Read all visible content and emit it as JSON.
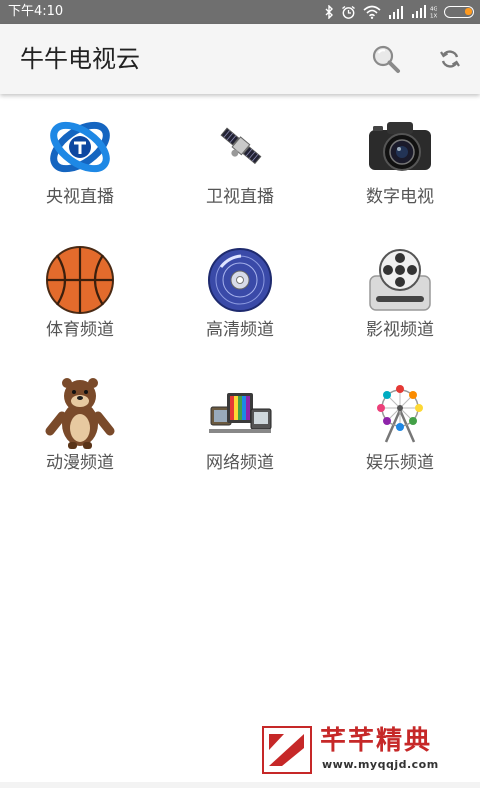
{
  "status_bar": {
    "time": "下午4:10",
    "icons": [
      "bluetooth-icon",
      "alarm-icon",
      "wifi-icon",
      "signal-icon",
      "signal-icon",
      "battery-icon"
    ],
    "battery_level": 0.25,
    "network_labels": [
      "4G",
      "1X"
    ]
  },
  "app_bar": {
    "title": "牛牛电视云",
    "actions": [
      "search-icon",
      "refresh-icon"
    ]
  },
  "grid": {
    "items": [
      {
        "label": "央视直播",
        "icon": "cctv-logo-icon"
      },
      {
        "label": "卫视直播",
        "icon": "satellite-icon"
      },
      {
        "label": "数字电视",
        "icon": "camera-icon"
      },
      {
        "label": "体育频道",
        "icon": "basketball-icon"
      },
      {
        "label": "高清频道",
        "icon": "disc-icon"
      },
      {
        "label": "影视频道",
        "icon": "film-reel-icon"
      },
      {
        "label": "动漫频道",
        "icon": "cartoon-bear-icon"
      },
      {
        "label": "网络频道",
        "icon": "tv-sets-icon"
      },
      {
        "label": "娱乐频道",
        "icon": "ferris-wheel-icon"
      }
    ]
  },
  "watermark": {
    "title": "芊芊精典",
    "url": "www.myqqjd.com"
  },
  "colors": {
    "status_bar_bg": "#6f6f6f",
    "app_bar_bg": "#f5f5f5",
    "watermark_red": "#c62828",
    "battery_orange": "#ff9a1f"
  }
}
